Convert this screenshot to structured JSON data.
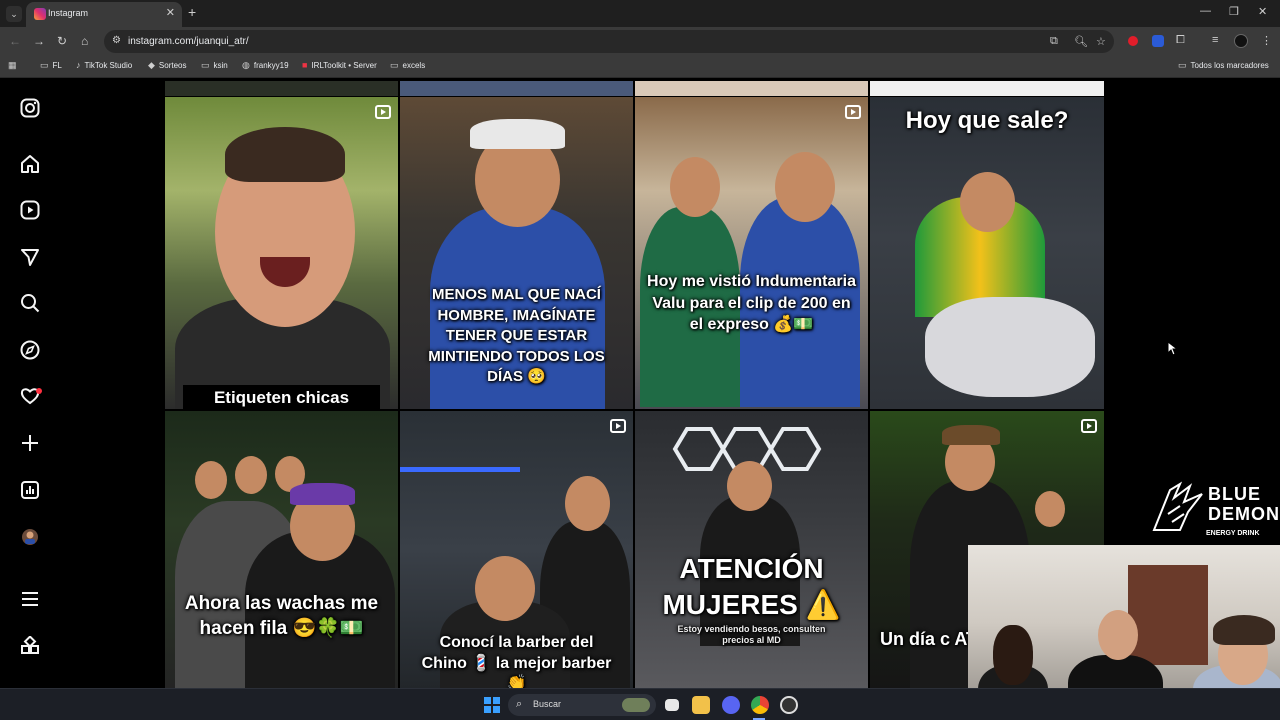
{
  "browser": {
    "tab_title": "Instagram",
    "url": "instagram.com/juanqui_atr/",
    "bookmarks": [
      {
        "label": "FL",
        "icon": "folder-icon"
      },
      {
        "label": "TikTok Studio",
        "icon": "tiktok-icon"
      },
      {
        "label": "Sorteos",
        "icon": "star-icon"
      },
      {
        "label": "ksin",
        "icon": "folder-icon"
      },
      {
        "label": "frankyy19",
        "icon": "globe-icon"
      },
      {
        "label": "IRLToolkit • Server",
        "icon": "irl-icon"
      },
      {
        "label": "excels",
        "icon": "folder-icon"
      }
    ],
    "all_bookmarks": "Todos los marcadores"
  },
  "sidebar": {
    "items": [
      "instagram-logo",
      "home",
      "reels",
      "messages",
      "search",
      "explore",
      "notifications",
      "create",
      "dashboard",
      "profile",
      "more",
      "also-from-meta"
    ]
  },
  "posts": [
    {
      "caption": "Etiqueten chicas",
      "reel": true
    },
    {
      "caption": "MENOS MAL QUE NACÍ HOMBRE, IMAGÍNATE TENER QUE ESTAR MINTIENDO TODOS LOS DÍAS 🥺",
      "reel": false
    },
    {
      "caption": "Hoy me vistió Indumentaria Valu para el clip de 200 en el expreso 💰💵",
      "reel": true
    },
    {
      "caption": "Hoy que sale?",
      "reel": false
    },
    {
      "caption": "Ahora las wachas me hacen fila 😎🍀💵",
      "reel": false
    },
    {
      "caption": "Conocí la barber del Chino 💈 la mejor barber 👏",
      "reel": true
    },
    {
      "caption": "ATENCIÓN MUJERES ⚠️",
      "subcaption": "Estoy vendiendo besos, consulten precios al MD",
      "reel": false
    },
    {
      "caption": "Un día c AT",
      "reel": true
    }
  ],
  "taskbar": {
    "search_placeholder": "Buscar"
  },
  "overlay": {
    "brand_line1": "BLUE",
    "brand_line2": "DEMON",
    "brand_line3": "ENERGY DRINK"
  }
}
